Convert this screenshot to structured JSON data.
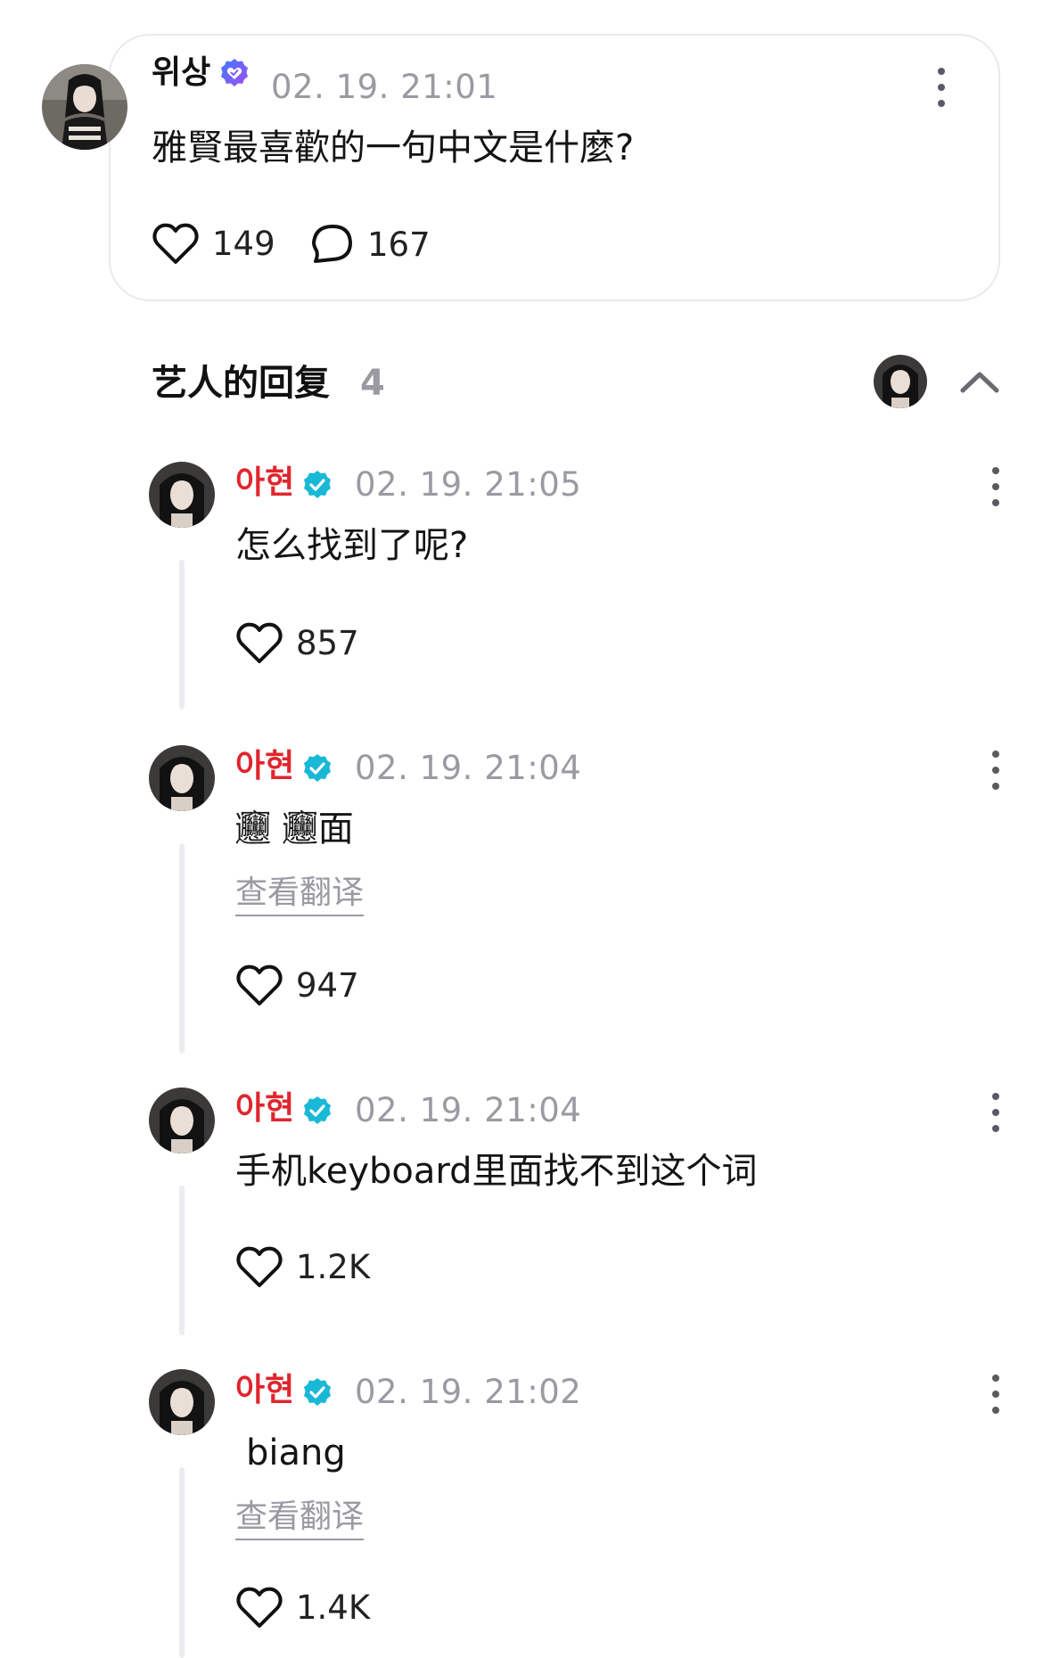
{
  "post": {
    "author": "위상",
    "timestamp": "02. 19. 21:01",
    "text": "雅賢最喜歡的一句中文是什麼?",
    "likes": "149",
    "comments": "167",
    "verified_icon": "heart-check-badge-icon",
    "verified_color": "#6b5cf6"
  },
  "replies_header": {
    "title": "艺人的回复",
    "count": "4"
  },
  "replies": [
    {
      "author": "아현",
      "timestamp": "02. 19. 21:05",
      "text": "怎么找到了呢?",
      "likes": "857",
      "translate_label": null
    },
    {
      "author": "아현",
      "timestamp": "02. 19. 21:04",
      "text": "𰻞 𰻞面",
      "likes": "947",
      "translate_label": "查看翻译"
    },
    {
      "author": "아현",
      "timestamp": "02. 19. 21:04",
      "text": "手机keyboard里面找不到这个词",
      "likes": "1.2K",
      "translate_label": null
    },
    {
      "author": "아현",
      "timestamp": "02. 19. 21:02",
      "text": "biang",
      "likes": "1.4K",
      "translate_label": "查看翻译"
    }
  ],
  "colors": {
    "reply_name": "#e0262e",
    "verified_teal": "#19b8d6",
    "muted_text": "#9a9aa3"
  }
}
